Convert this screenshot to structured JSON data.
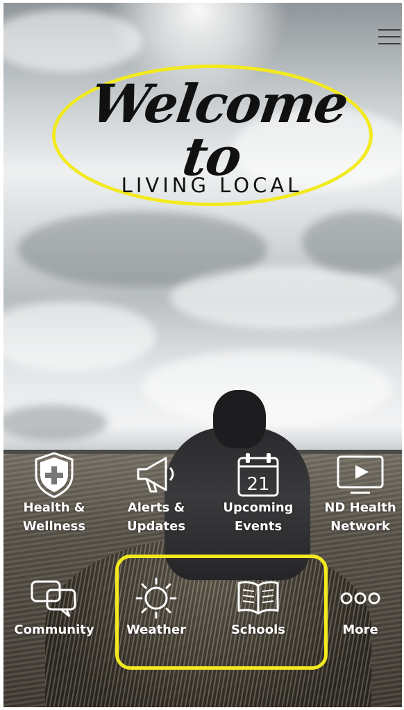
{
  "header": {
    "menu_icon": "hamburger-icon",
    "title": "Welcome to",
    "subtitle": "LIVING LOCAL"
  },
  "tiles": [
    {
      "label_line1": "Health &",
      "label_line2": "Wellness",
      "icon": "shield-plus-icon"
    },
    {
      "label_line1": "Alerts &",
      "label_line2": "Updates",
      "icon": "megaphone-icon"
    },
    {
      "label_line1": "Upcoming",
      "label_line2": "Events",
      "icon": "calendar-icon",
      "icon_text": "21"
    },
    {
      "label_line1": "ND Health",
      "label_line2": "Network",
      "icon": "tv-play-icon"
    },
    {
      "label": "Community",
      "icon": "chat-bubbles-icon"
    },
    {
      "label": "Weather",
      "icon": "sun-icon"
    },
    {
      "label": "Schools",
      "icon": "open-book-icon"
    },
    {
      "label": "More",
      "icon": "more-dots-icon"
    }
  ],
  "colors": {
    "highlight": "#f2ea1f",
    "icon": "#ffffff"
  }
}
